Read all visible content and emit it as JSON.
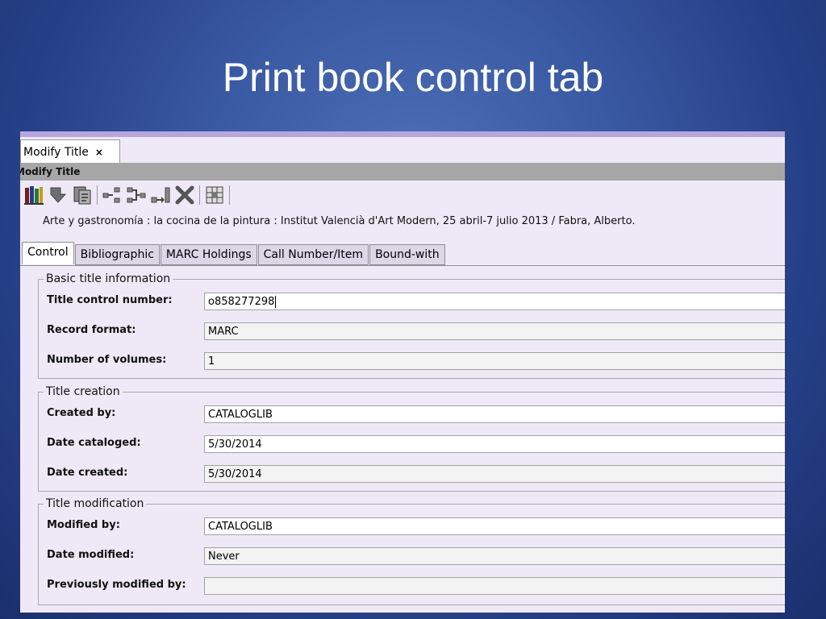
{
  "slide": {
    "title": "Print book control tab"
  },
  "window": {
    "doc_tab": "Modify Title",
    "doc_tab_close": "×",
    "title_bar": "Modify Title"
  },
  "toolbar": {
    "icons": [
      "book-stack-icon",
      "arrow-down-icon",
      "copy-record-icon",
      "split-icon",
      "merge-icon",
      "transfer-icon",
      "delete-icon",
      "grid-icon"
    ]
  },
  "record": {
    "heading": "Arte y gastronomía : la cocina de la pintura : Institut Valencià d'Art Modern, 25 abril-7 julio 2013 / Fabra, Alberto."
  },
  "tabs": [
    {
      "label": "Control",
      "active": true
    },
    {
      "label": "Bibliographic",
      "active": false
    },
    {
      "label": "MARC Holdings",
      "active": false
    },
    {
      "label": "Call Number/Item",
      "active": false
    },
    {
      "label": "Bound-with",
      "active": false
    }
  ],
  "groups": {
    "basic": {
      "legend": "Basic title information",
      "rows": [
        {
          "label": "Title control number:",
          "value": "o858277298"
        },
        {
          "label": "Record format:",
          "value": "MARC"
        },
        {
          "label": "Number of volumes:",
          "value": "1"
        }
      ]
    },
    "creation": {
      "legend": "Title creation",
      "rows": [
        {
          "label": "Created by:",
          "value": "CATALOGLIB"
        },
        {
          "label": "Date cataloged:",
          "value": "5/30/2014"
        },
        {
          "label": "Date created:",
          "value": "5/30/2014"
        }
      ]
    },
    "modification": {
      "legend": "Title modification",
      "rows": [
        {
          "label": "Modified by:",
          "value": "CATALOGLIB"
        },
        {
          "label": "Date modified:",
          "value": "Never"
        },
        {
          "label": "Previously modified by:",
          "value": ""
        }
      ]
    }
  },
  "colors": {
    "background": "#3a5aa3",
    "panel": "#efe9f7",
    "title_bar": "#a6a6a6",
    "accent_strip": "#b7a6dc"
  }
}
